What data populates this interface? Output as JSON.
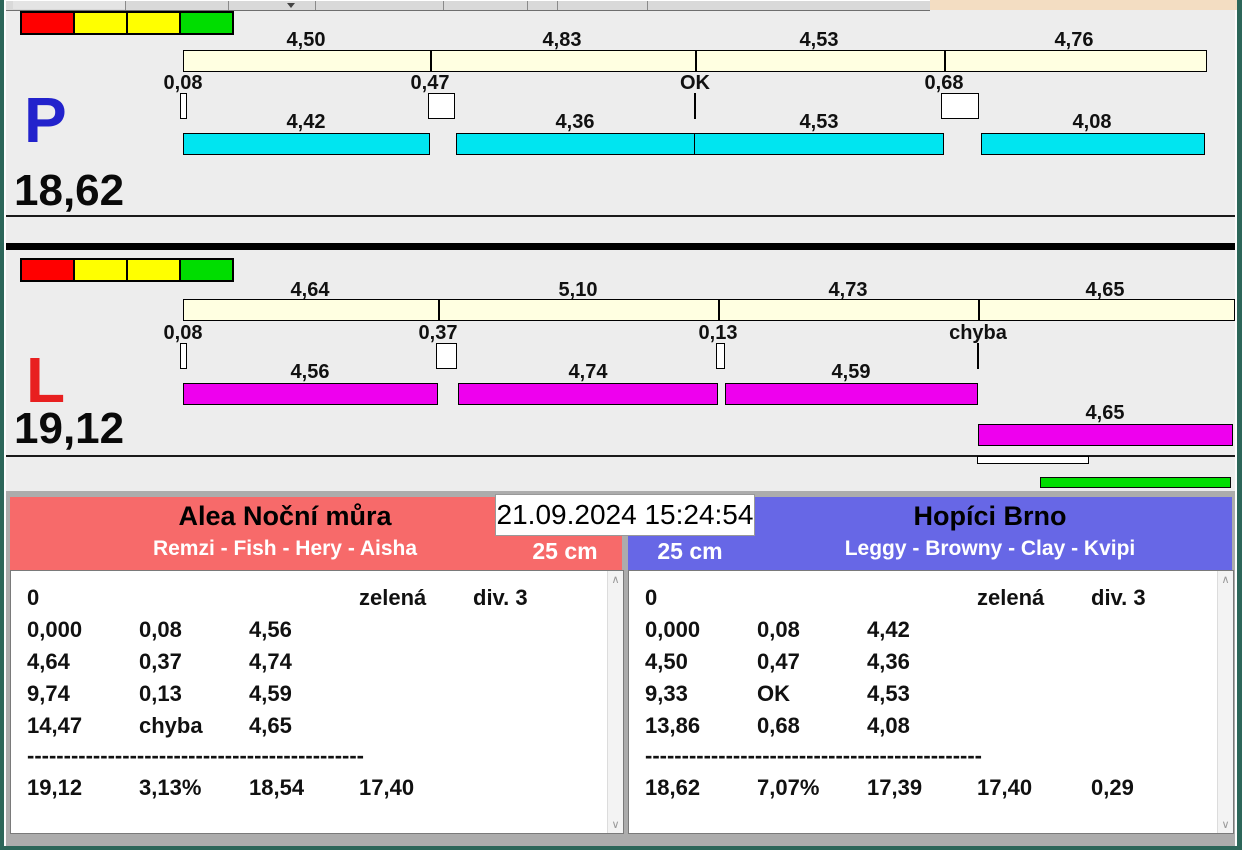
{
  "datetime": "21.09.2024 15:24:54",
  "icons": {
    "scroll_up": "∧",
    "scroll_down": "∨"
  },
  "lanes": {
    "p": {
      "letter": "P",
      "total": "18,62",
      "lights": [
        "red",
        "yellow",
        "yellow",
        "green"
      ],
      "top_segments": [
        "4,50",
        "4,83",
        "4,53",
        "4,76"
      ],
      "gaps": [
        "0,08",
        "0,47",
        "OK",
        "0,68"
      ],
      "run_segments": [
        "4,42",
        "4,36",
        "4,53",
        "4,08"
      ]
    },
    "l": {
      "letter": "L",
      "total": "19,12",
      "lights": [
        "red",
        "yellow",
        "yellow",
        "green"
      ],
      "top_segments": [
        "4,64",
        "5,10",
        "4,73",
        "4,65"
      ],
      "gaps": [
        "0,08",
        "0,37",
        "0,13",
        "chyba"
      ],
      "run_segments": [
        "4,56",
        "4,74",
        "4,59"
      ],
      "rerun_segment": "4,65"
    }
  },
  "teams": {
    "left": {
      "name": "Alea Noční můra",
      "members": "Remzi - Fish - Hery - Aisha",
      "height": "25 cm",
      "divider": "----------------------------------------------",
      "rows": [
        [
          "0",
          "",
          "",
          "zelená",
          "div. 3"
        ],
        [
          "0,000",
          "0,08",
          "4,56",
          "",
          ""
        ],
        [
          "4,64",
          "0,37",
          "4,74",
          "",
          ""
        ],
        [
          "9,74",
          "0,13",
          "4,59",
          "",
          ""
        ],
        [
          "14,47",
          "chyba",
          "4,65",
          "",
          ""
        ],
        [
          "19,12",
          "3,13%",
          "18,54",
          "17,40",
          ""
        ]
      ]
    },
    "right": {
      "name": "Hopíci Brno",
      "members": "Leggy - Browny - Clay - Kvipi",
      "height": "25 cm",
      "divider": "----------------------------------------------",
      "rows": [
        [
          "0",
          "",
          "",
          "zelená",
          "div. 3"
        ],
        [
          "0,000",
          "0,08",
          "4,42",
          "",
          ""
        ],
        [
          "4,50",
          "0,47",
          "4,36",
          "",
          ""
        ],
        [
          "9,33",
          "OK",
          "4,53",
          "",
          ""
        ],
        [
          "13,86",
          "0,68",
          "4,08",
          "",
          ""
        ],
        [
          "18,62",
          "7,07%",
          "17,39",
          "17,40",
          "0,29"
        ]
      ]
    }
  },
  "colors": {
    "split_bar": "#FFFFE1",
    "lane_p_run_bar": "#00E5F0",
    "lane_l_run_bar": "#EE00EE",
    "lane_p_letter": "#2222CC",
    "lane_l_letter": "#E82020",
    "team_left_header": "#F76A6A",
    "team_right_header": "#6767E6",
    "light_red": "#FF0000",
    "light_yellow": "#FFFF00",
    "light_green": "#00DD00",
    "progress_green": "#00DD00",
    "window_border": "#2C6659"
  }
}
